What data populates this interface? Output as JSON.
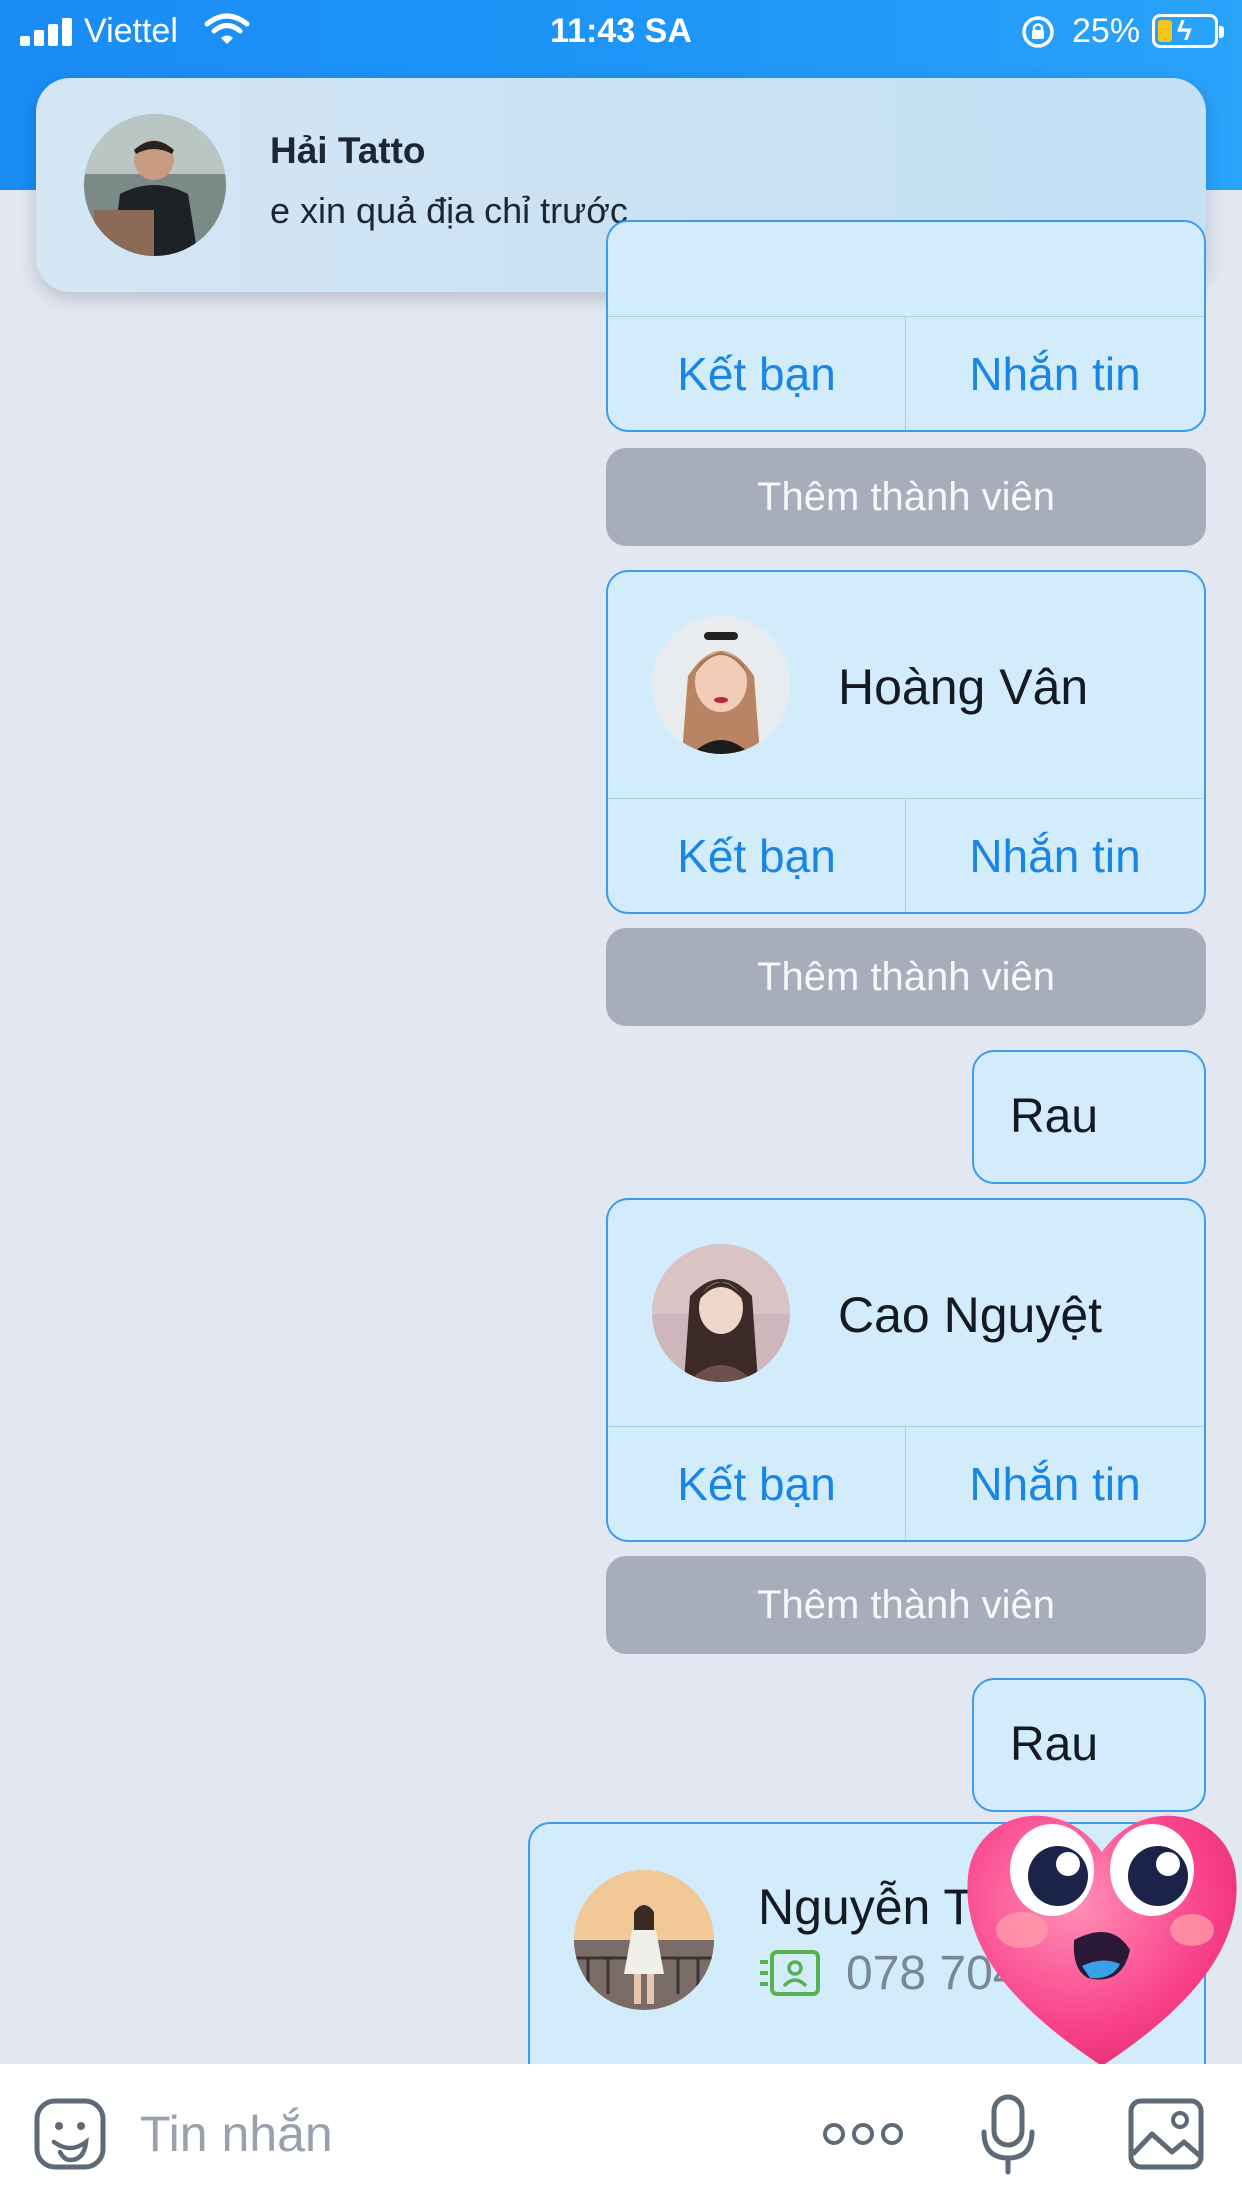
{
  "status_bar": {
    "carrier": "Viettel",
    "time": "11:43 SA",
    "battery_percent": "25%",
    "battery_level": 0.25,
    "icons": [
      "signal-icon",
      "wifi-icon",
      "rotation-lock-icon",
      "battery-charging-icon"
    ]
  },
  "notification": {
    "sender": "Hải Tatto",
    "message": "e xin quả địa chỉ trước"
  },
  "messages": {
    "card_actions": {
      "add_friend": "Kết bạn",
      "message": "Nhắn tin"
    },
    "add_member_label": "Thêm thành viên",
    "contacts": [
      {
        "name": "Hoàng Vân"
      },
      {
        "name": "Cao Nguyệt"
      },
      {
        "name": "Nguyễn T",
        "phone": "078 704"
      }
    ],
    "text_messages": [
      "Rau",
      "Rau"
    ]
  },
  "input_bar": {
    "placeholder": "Tin nhắn"
  },
  "colors": {
    "header_blue": "#1f97f8",
    "chat_background": "#e2e7f2",
    "bubble_fill": "#d3ecfb",
    "bubble_border": "#3a9cec",
    "action_text": "#1a86e3",
    "add_member_bg": "#a7adba"
  }
}
